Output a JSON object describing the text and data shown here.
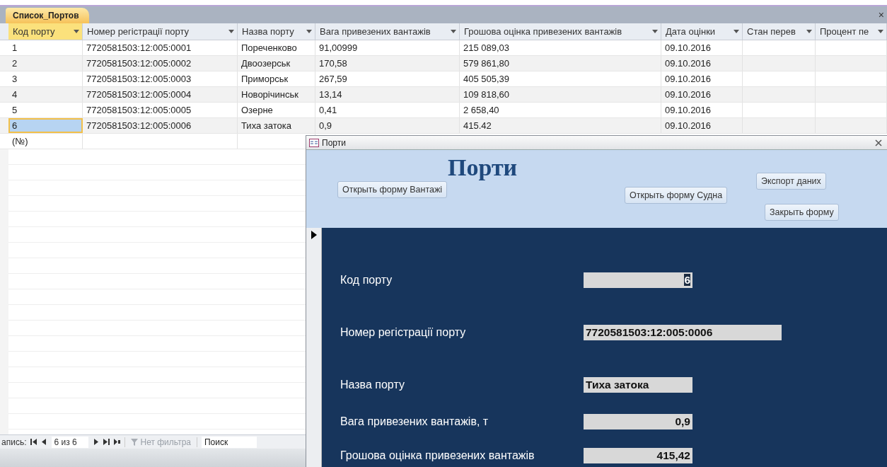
{
  "datasheet": {
    "tab": "Список_Портов",
    "close": "×",
    "columns": [
      {
        "label": "Код порту",
        "selected": true
      },
      {
        "label": "Номер регістрації порту",
        "selected": false
      },
      {
        "label": "Назва порту",
        "selected": false
      },
      {
        "label": "Вага привезених вантажів",
        "selected": false
      },
      {
        "label": "Грошова оцінка привезених вантажів",
        "selected": false
      },
      {
        "label": "Дата оцінки",
        "selected": false
      },
      {
        "label": "Стан перев",
        "selected": false
      },
      {
        "label": "Процент пе",
        "selected": false
      }
    ],
    "rows": [
      {
        "cells": [
          "1",
          "7720581503:12:005:0001",
          "Пореченково",
          "91,00999",
          "215 089,03",
          "09.10.2016"
        ],
        "selected": false
      },
      {
        "cells": [
          "2",
          "7720581503:12:005:0002",
          "Двоозерськ",
          "170,58",
          "579 861,80",
          "09.10.2016"
        ],
        "selected": false
      },
      {
        "cells": [
          "3",
          "7720581503:12:005:0003",
          "Приморськ",
          "267,59",
          "405 505,39",
          "09.10.2016"
        ],
        "selected": false
      },
      {
        "cells": [
          "4",
          "7720581503:12:005:0004",
          "Новорічинськ",
          "13,14",
          "109 818,60",
          "09.10.2016"
        ],
        "selected": false
      },
      {
        "cells": [
          "5",
          "7720581503:12:005:0005",
          "Озерне",
          "0,41",
          "2 658,40",
          "09.10.2016"
        ],
        "selected": false
      },
      {
        "cells": [
          "6",
          "7720581503:12:005:0006",
          "Тиха затока",
          "0,9",
          "415.42",
          "09.10.2016"
        ],
        "selected": true
      }
    ],
    "new_row": "(№)",
    "navigator": {
      "label": "апись:",
      "position": "6 из 6",
      "filter": "Нет фильтра",
      "search": "Поиск"
    }
  },
  "form": {
    "title": "Порти",
    "heading": "Порти",
    "buttons": [
      "Открыть форму Вантажі",
      "Открыть форму Судна",
      "Экспорт даних",
      "Закрыть форму"
    ],
    "fields": [
      {
        "label": "Код порту",
        "value": "6",
        "kind": "number"
      },
      {
        "label": "Номер регістрації порту",
        "value": "7720581503:12:005:0006",
        "kind": "text"
      },
      {
        "label": "Назва порту",
        "value": "Тиха затока",
        "kind": "text"
      },
      {
        "label": "Вага привезених вантажів, т",
        "value": "0,9",
        "kind": "number"
      },
      {
        "label": "Грошова оцінка привезених вантажів",
        "value": "415,42",
        "kind": "number"
      }
    ]
  }
}
